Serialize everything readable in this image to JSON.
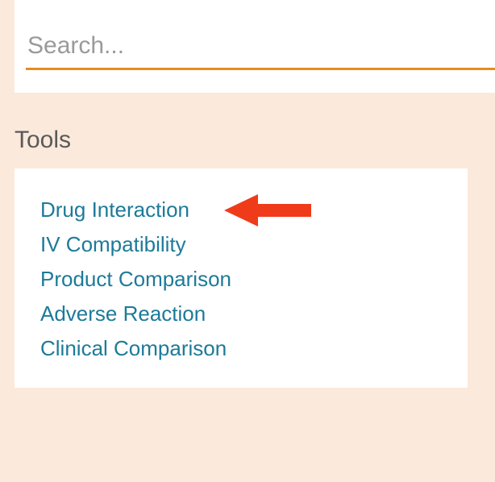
{
  "search": {
    "placeholder": "Search..."
  },
  "tools": {
    "heading": "Tools",
    "items": [
      "Drug Interaction",
      "IV Compatibility",
      "Product Comparison",
      "Adverse Reaction",
      "Clinical Comparison"
    ]
  },
  "annotation": {
    "target": "drug-interaction",
    "color": "#f03b1a"
  }
}
